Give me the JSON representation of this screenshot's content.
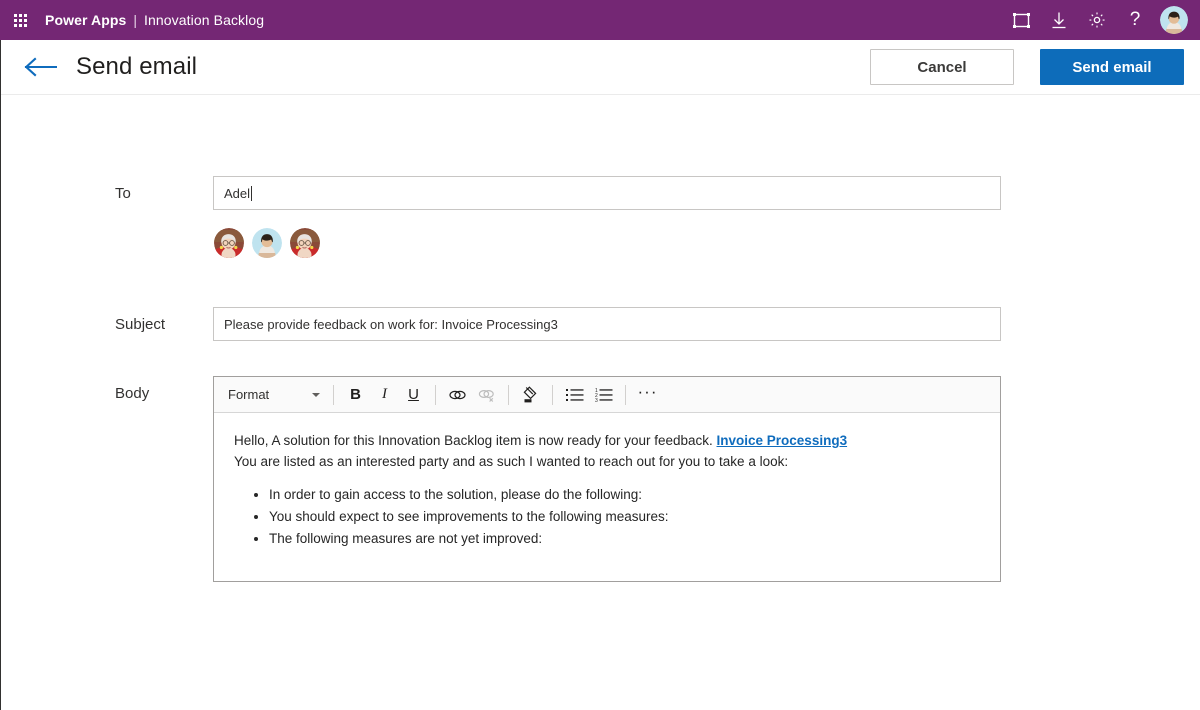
{
  "suite": {
    "waffle_icon": "app-launcher-icon",
    "app_name": "Power Apps",
    "separator": "|",
    "environment": "Innovation Backlog",
    "icons": [
      {
        "name": "screen-frame-icon",
        "label": "Play"
      },
      {
        "name": "download-icon",
        "label": "Download"
      },
      {
        "name": "gear-icon",
        "label": "Settings"
      },
      {
        "name": "help-icon",
        "label": "?"
      }
    ],
    "account_avatar": "user-avatar"
  },
  "command_bar": {
    "back_icon": "back-arrow-icon",
    "title": "Send email",
    "cancel_label": "Cancel",
    "send_label": "Send email"
  },
  "form": {
    "to": {
      "label": "To",
      "value": "Adel",
      "placeholder": "",
      "recipients": [
        {
          "name": "recipient-avatar-1"
        },
        {
          "name": "recipient-avatar-2"
        },
        {
          "name": "recipient-avatar-3"
        }
      ]
    },
    "subject": {
      "label": "Subject",
      "value": "Please provide feedback on work for: Invoice Processing3",
      "placeholder": ""
    },
    "body": {
      "label": "Body",
      "toolbar": {
        "format_label": "Format",
        "bold_label": "B",
        "italic_label": "I",
        "underline_label": "U",
        "link_label": "link-icon",
        "unlink_label": "unlink-icon",
        "highlight_label": "format-painter-icon",
        "bullet_list_label": "bulleted-list-icon",
        "number_list_label": "numbered-list-icon",
        "more_label": "···"
      },
      "content": {
        "line1_pre": "Hello, A solution for this Innovation Backlog item is now ready for your feedback. ",
        "line1_link": "Invoice Processing3",
        "line2": "You are listed as an interested party and as such I wanted to reach out for you to take a look:",
        "bullets": [
          "In order to gain access to the solution, please do the following:",
          "You should expect to see improvements to the following measures:",
          "The following measures are not yet improved:"
        ]
      }
    }
  },
  "colors": {
    "suite_purple": "#742774",
    "primary_button": "#0d6cba",
    "link_blue": "#0f6cbd",
    "back_arrow_blue": "#0f6cbd"
  }
}
